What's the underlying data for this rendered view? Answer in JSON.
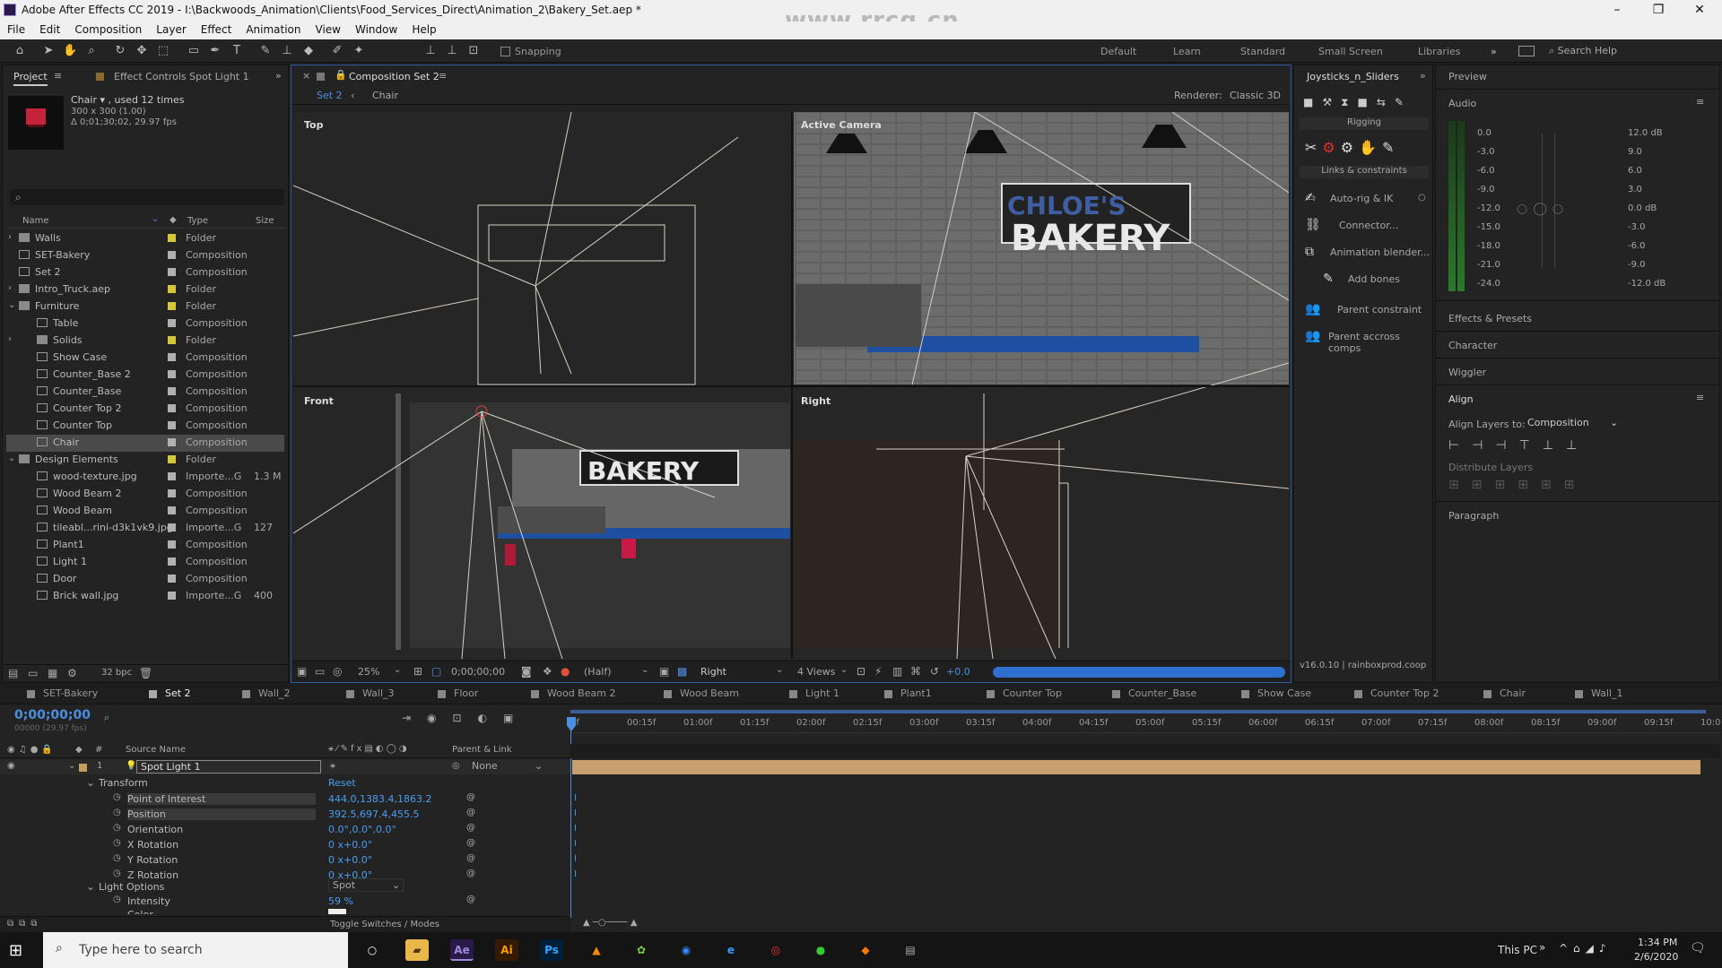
{
  "window": {
    "title": "Adobe After Effects CC 2019 - I:\\Backwoods_Animation\\Clients\\Food_Services_Direct\\Animation_2\\Bakery_Set.aep *",
    "watermark": "www.rrcg.cn"
  },
  "menu": [
    "File",
    "Edit",
    "Composition",
    "Layer",
    "Effect",
    "Animation",
    "View",
    "Window",
    "Help"
  ],
  "toolbar": {
    "snapping": "Snapping",
    "workspaces": [
      "Default",
      "Learn",
      "Standard",
      "Small Screen",
      "Libraries"
    ],
    "search_help": "Search Help"
  },
  "project": {
    "tab": "Project",
    "effect_controls_tab": "Effect Controls Spot Light 1",
    "selected_name": "Chair ▾ , used 12 times",
    "selected_size": "300 x 300 (1.00)",
    "selected_duration": "Δ 0;01;30;02, 29.97 fps",
    "col_name": "Name",
    "col_type": "Type",
    "col_size": "Size",
    "bpc": "32 bpc",
    "items": [
      {
        "name": "Walls",
        "type": "Folder",
        "size": "",
        "indent": 0,
        "kind": "folder",
        "arrow": "›"
      },
      {
        "name": "SET-Bakery",
        "type": "Composition",
        "size": "",
        "indent": 0,
        "kind": "comp",
        "arrow": ""
      },
      {
        "name": "Set 2",
        "type": "Composition",
        "size": "",
        "indent": 0,
        "kind": "comp",
        "arrow": ""
      },
      {
        "name": "Intro_Truck.aep",
        "type": "Folder",
        "size": "",
        "indent": 0,
        "kind": "folder",
        "arrow": "›"
      },
      {
        "name": "Furniture",
        "type": "Folder",
        "size": "",
        "indent": 0,
        "kind": "folder",
        "arrow": "⌄"
      },
      {
        "name": "Table",
        "type": "Composition",
        "size": "",
        "indent": 1,
        "kind": "comp",
        "arrow": ""
      },
      {
        "name": "Solids",
        "type": "Folder",
        "size": "",
        "indent": 1,
        "kind": "folder",
        "arrow": "›"
      },
      {
        "name": "Show Case",
        "type": "Composition",
        "size": "",
        "indent": 1,
        "kind": "comp",
        "arrow": ""
      },
      {
        "name": "Counter_Base 2",
        "type": "Composition",
        "size": "",
        "indent": 1,
        "kind": "comp",
        "arrow": ""
      },
      {
        "name": "Counter_Base",
        "type": "Composition",
        "size": "",
        "indent": 1,
        "kind": "comp",
        "arrow": ""
      },
      {
        "name": "Counter Top 2",
        "type": "Composition",
        "size": "",
        "indent": 1,
        "kind": "comp",
        "arrow": ""
      },
      {
        "name": "Counter Top",
        "type": "Composition",
        "size": "",
        "indent": 1,
        "kind": "comp",
        "arrow": ""
      },
      {
        "name": "Chair",
        "type": "Composition",
        "size": "",
        "indent": 1,
        "kind": "comp",
        "arrow": "",
        "selected": true
      },
      {
        "name": "Design Elements",
        "type": "Folder",
        "size": "",
        "indent": 0,
        "kind": "folder",
        "arrow": "⌄"
      },
      {
        "name": "wood-texture.jpg",
        "type": "Importe...G",
        "size": "1.3 M",
        "indent": 1,
        "kind": "file",
        "arrow": ""
      },
      {
        "name": "Wood Beam 2",
        "type": "Composition",
        "size": "",
        "indent": 1,
        "kind": "comp",
        "arrow": ""
      },
      {
        "name": "Wood Beam",
        "type": "Composition",
        "size": "",
        "indent": 1,
        "kind": "comp",
        "arrow": ""
      },
      {
        "name": "tileabl...rini-d3k1vk9.jpg",
        "type": "Importe...G",
        "size": "127",
        "indent": 1,
        "kind": "file",
        "arrow": ""
      },
      {
        "name": "Plant1",
        "type": "Composition",
        "size": "",
        "indent": 1,
        "kind": "comp",
        "arrow": ""
      },
      {
        "name": "Light 1",
        "type": "Composition",
        "size": "",
        "indent": 1,
        "kind": "comp",
        "arrow": ""
      },
      {
        "name": "Door",
        "type": "Composition",
        "size": "",
        "indent": 1,
        "kind": "comp",
        "arrow": ""
      },
      {
        "name": "Brick wall.jpg",
        "type": "Importe...G",
        "size": "400",
        "indent": 1,
        "kind": "file",
        "arrow": ""
      }
    ]
  },
  "composition": {
    "tab": "Composition Set 2",
    "crumb1": "Set 2",
    "crumb2": "Chair",
    "renderer_label": "Renderer:",
    "renderer": "Classic 3D",
    "views": {
      "top": "Top",
      "active": "Active Camera",
      "front": "Front",
      "right": "Right"
    },
    "sign": "BAKERY",
    "sign_top": "CHLOE'S",
    "footer": {
      "zoom": "25%",
      "time": "0;00;00;00",
      "resolution": "(Half)",
      "view": "Right",
      "layout": "4 Views",
      "exposure": "+0.0"
    }
  },
  "joysticks": {
    "tab": "Joysticks_n_Sliders",
    "rigging": "Rigging",
    "links": "Links & constraints",
    "items": [
      "Auto-rig & IK",
      "Connector...",
      "Animation blender...",
      "Add bones",
      "Parent constraint",
      "Parent accross comps"
    ],
    "version": "v16.0.10 | rainboxprod.coop"
  },
  "right": {
    "preview": "Preview",
    "audio": "Audio",
    "audio_left": [
      "0.0",
      "-3.0",
      "-6.0",
      "-9.0",
      "-12.0",
      "-15.0",
      "-18.0",
      "-21.0",
      "-24.0"
    ],
    "audio_right": [
      "12.0 dB",
      "9.0",
      "6.0",
      "3.0",
      "0.0 dB",
      "-3.0",
      "-6.0",
      "-9.0",
      "-12.0 dB"
    ],
    "effects_presets": "Effects & Presets",
    "character": "Character",
    "wiggler": "Wiggler",
    "align": "Align",
    "align_to_label": "Align Layers to:",
    "align_to": "Composition",
    "distribute": "Distribute Layers",
    "paragraph": "Paragraph"
  },
  "timeline": {
    "tabs": [
      "SET-Bakery",
      "Set 2",
      "Wall_2",
      "Wall_3",
      "Floor",
      "Wood Beam 2",
      "Wood Beam",
      "Light 1",
      "Plant1",
      "Counter Top",
      "Counter_Base",
      "Show Case",
      "Counter Top 2",
      "Chair",
      "Wall_1"
    ],
    "timecode": "0;00;00;00",
    "fps": "00000 (29.97 fps)",
    "col_source": "Source Name",
    "col_parent": "Parent & Link",
    "layer_num": "1",
    "layer_name": "Spot Light 1",
    "parent": "None",
    "transform": "Transform",
    "reset": "Reset",
    "props": [
      {
        "name": "Point of Interest",
        "value": "444.0,1383.4,1863.2"
      },
      {
        "name": "Position",
        "value": "392.5,697.4,455.5"
      },
      {
        "name": "Orientation",
        "value": "0.0°,0.0°,0.0°"
      },
      {
        "name": "X Rotation",
        "value": "0 x+0.0°"
      },
      {
        "name": "Y Rotation",
        "value": "0 x+0.0°"
      },
      {
        "name": "Z Rotation",
        "value": "0 x+0.0°"
      }
    ],
    "light_options": "Light Options",
    "light_type": "Spot",
    "intensity_label": "Intensity",
    "intensity": "59 %",
    "color_label": "Color",
    "toggle": "Toggle Switches / Modes",
    "ruler": [
      "0f",
      "00:15f",
      "01:00f",
      "01:15f",
      "02:00f",
      "02:15f",
      "03:00f",
      "03:15f",
      "04:00f",
      "04:15f",
      "05:00f",
      "05:15f",
      "06:00f",
      "06:15f",
      "07:00f",
      "07:15f",
      "08:00f",
      "08:15f",
      "09:00f",
      "09:15f",
      "10:0"
    ]
  },
  "taskbar": {
    "search": "Type here to search",
    "this_pc": "This PC",
    "time": "1:34 PM",
    "date": "2/6/2020"
  }
}
